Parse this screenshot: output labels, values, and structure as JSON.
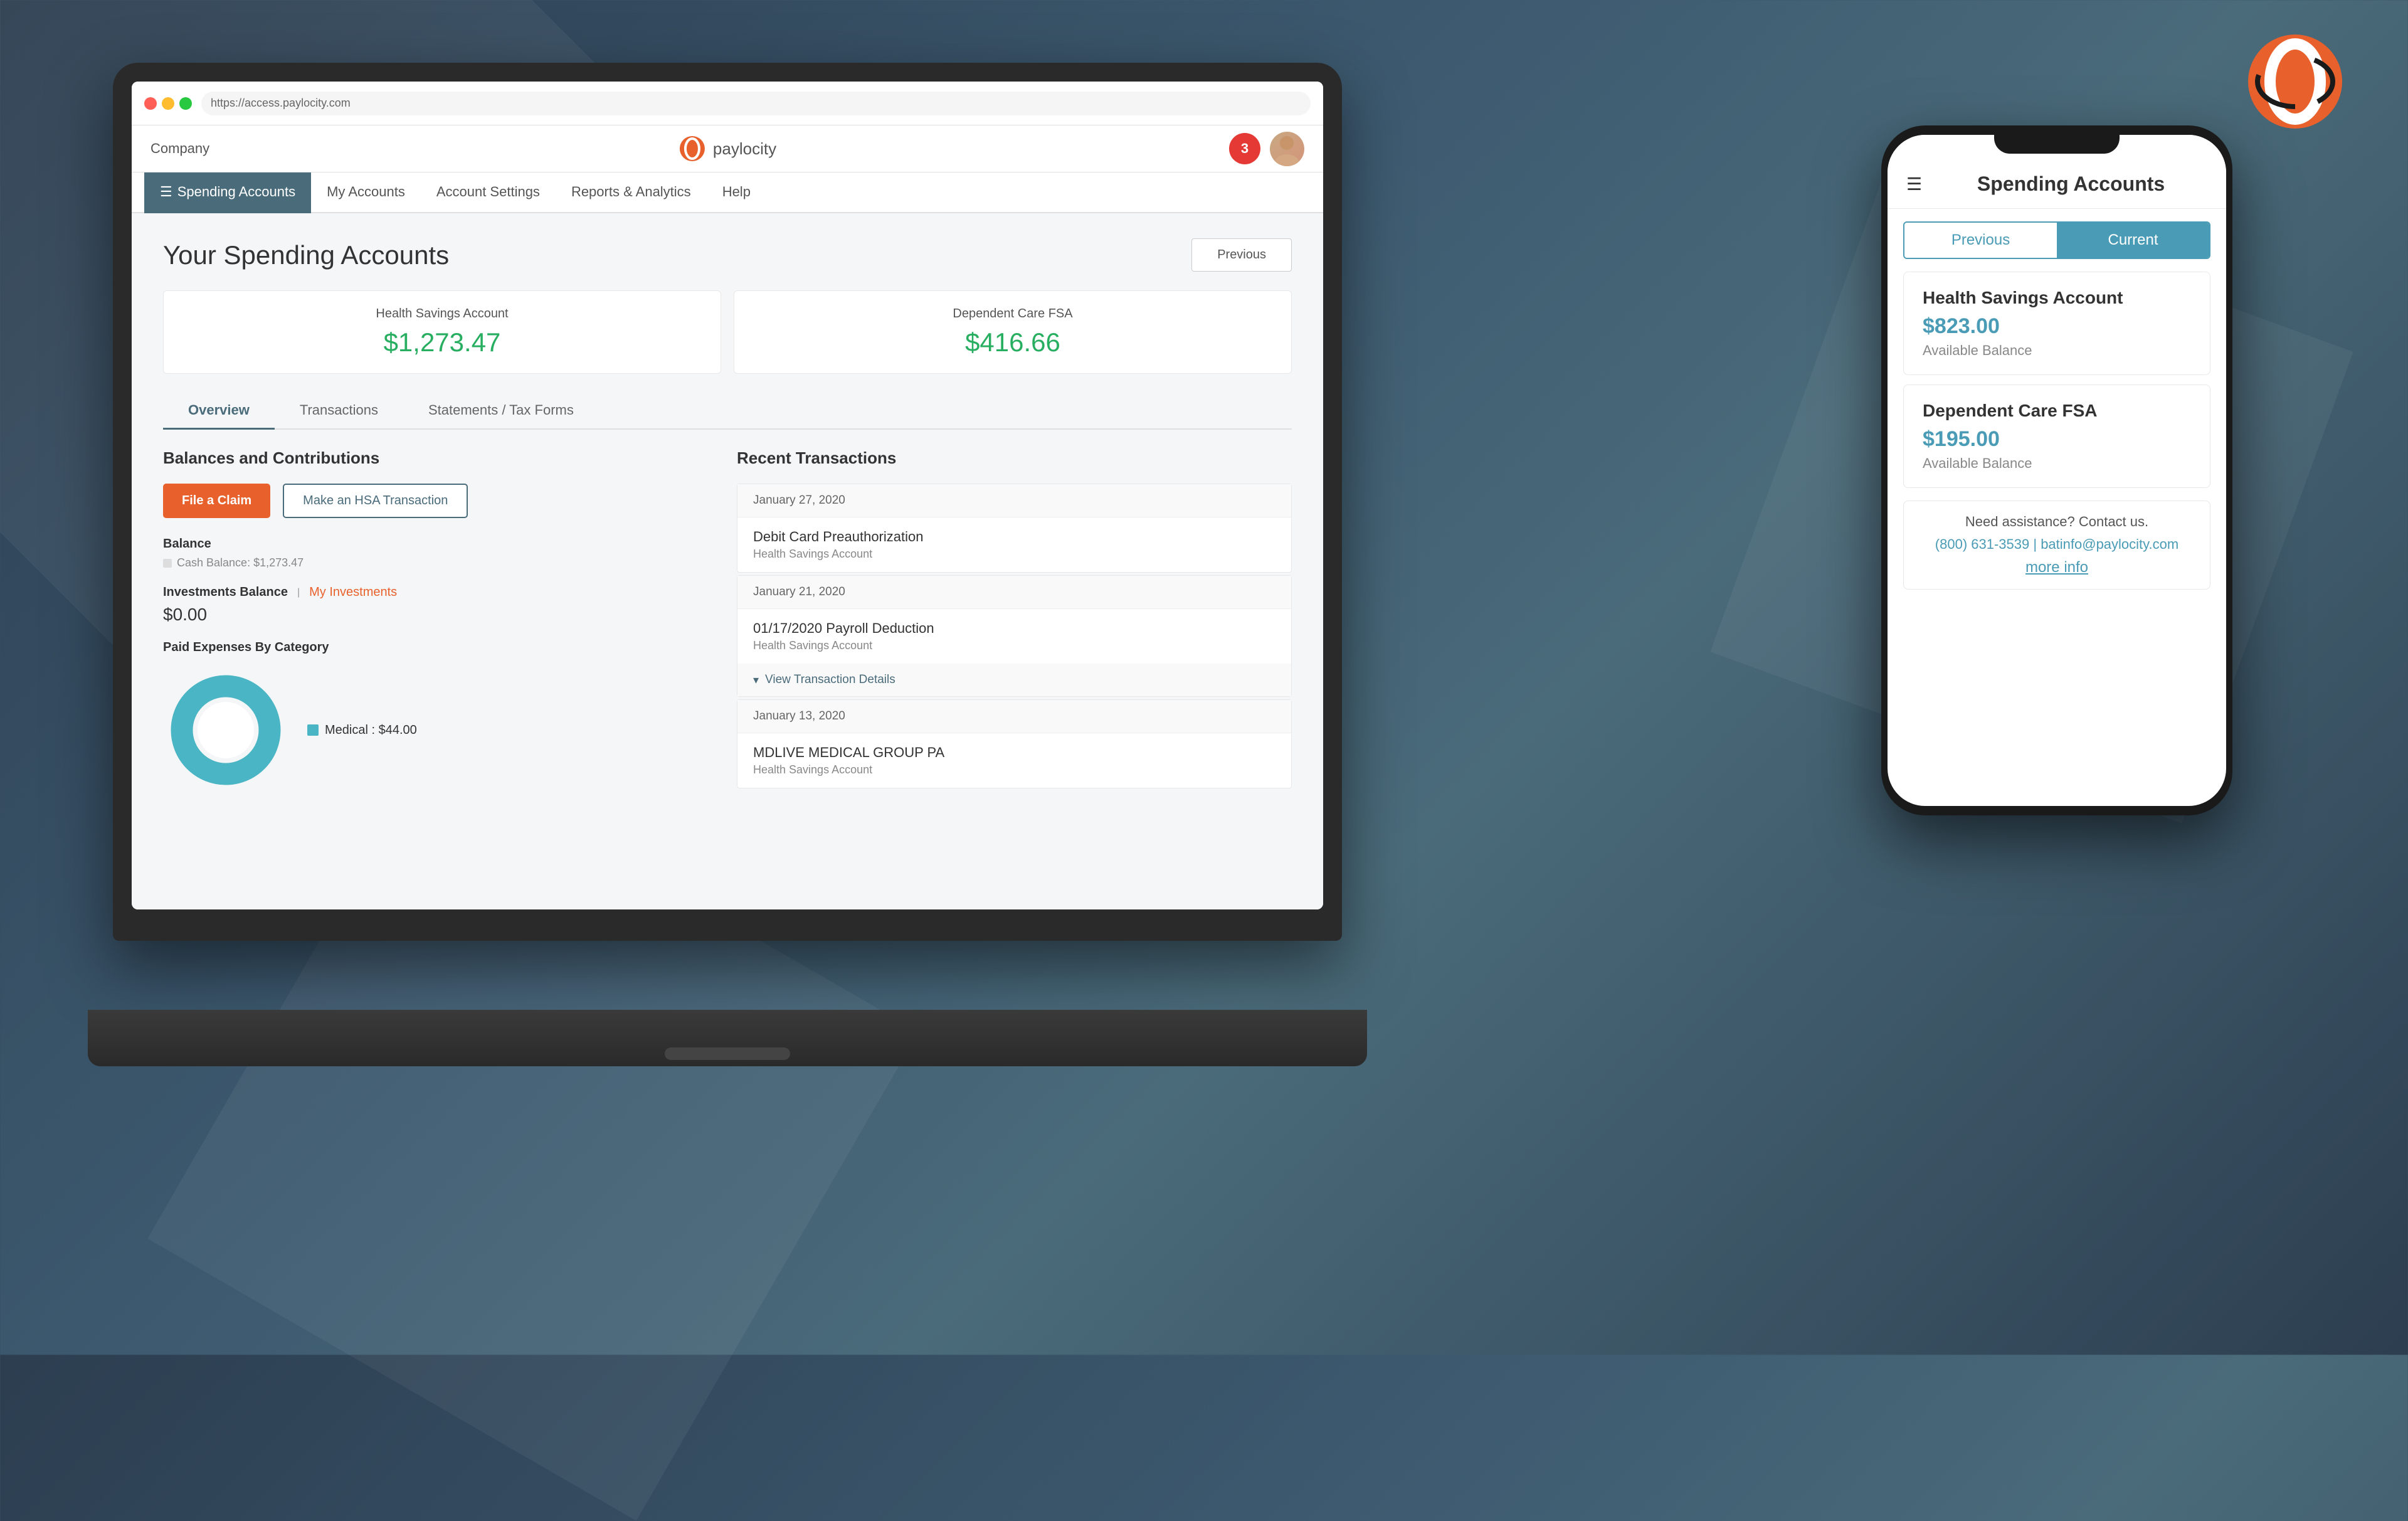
{
  "background": {
    "color": "#2c4a5a"
  },
  "corner_logo": {
    "alt": "Paylocity Logo"
  },
  "laptop": {
    "browser": {
      "url": "https://access.paylocity.com"
    },
    "app_header": {
      "company": "Company",
      "notification_count": "3",
      "logo_text": "paylocity"
    },
    "nav": {
      "items": [
        {
          "label": "Spending Accounts",
          "active": true
        },
        {
          "label": "My Accounts",
          "active": false
        },
        {
          "label": "Account Settings",
          "active": false
        },
        {
          "label": "Reports & Analytics",
          "active": false
        },
        {
          "label": "Help",
          "active": false
        }
      ]
    },
    "page_title": "Your Spending Accounts",
    "previous_btn": "Previous",
    "account_cards": [
      {
        "title": "Health Savings Account",
        "balance": "$1,273.47"
      },
      {
        "title": "Dependent Care FSA",
        "balance": "$416.66"
      }
    ],
    "tabs": [
      {
        "label": "Overview",
        "active": true
      },
      {
        "label": "Transactions",
        "active": false
      },
      {
        "label": "Statements / Tax Forms",
        "active": false
      }
    ],
    "left_panel": {
      "section_title": "Balances and Contributions",
      "btn_file_claim": "File a Claim",
      "btn_hsa_transaction": "Make an HSA Transaction",
      "balance_label": "Balance",
      "cash_balance": "Cash Balance: $1,273.47",
      "investments_label": "Investments Balance",
      "investments_link": "My Investments",
      "investments_separator": "|",
      "investments_amount": "$0.00",
      "expenses_title": "Paid Expenses By Category",
      "chart": {
        "segments": [
          {
            "label": "Medical",
            "value": 44,
            "color": "#4ab5c4",
            "percent": 100
          }
        ],
        "legend": "Medical : $44.00"
      }
    },
    "right_panel": {
      "section_title": "Recent Transactions",
      "transactions": [
        {
          "date": "January 27, 2020",
          "name": "Debit Card Preauthorization",
          "account": "Health Savings Account"
        },
        {
          "date": "January 21, 2020",
          "name": "01/17/2020 Payroll Deduction",
          "account": "Health Savings Account"
        },
        {
          "date": "January 13, 2020",
          "name": "MDLIVE MEDICAL GROUP PA",
          "account": "Health Savings Account"
        }
      ],
      "view_details": "View Transaction Details"
    }
  },
  "phone": {
    "header_title": "Spending Accounts",
    "toggle": {
      "previous": "Previous",
      "current": "Current"
    },
    "accounts": [
      {
        "name": "Health Savings Account",
        "balance": "$823.00",
        "balance_label": "Available Balance"
      },
      {
        "name": "Dependent Care FSA",
        "balance": "$195.00",
        "balance_label": "Available Balance"
      }
    ],
    "assistance": {
      "text": "Need assistance? Contact us.",
      "phone": "(800) 631-3539",
      "separator": "|",
      "email": "batinfo@paylocity.com",
      "more_info": "more info"
    }
  }
}
